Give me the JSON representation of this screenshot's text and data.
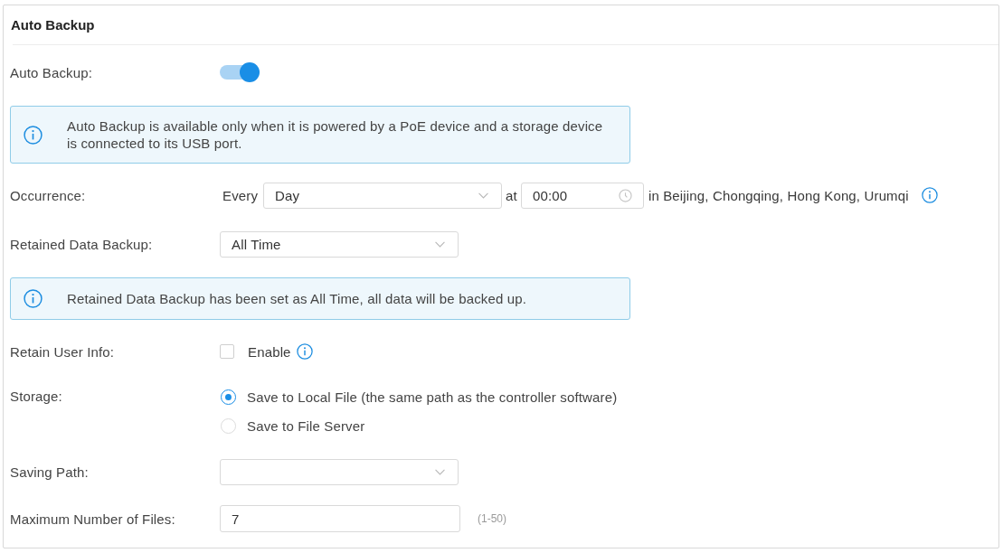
{
  "panel": {
    "title": "Auto Backup"
  },
  "rows": [
    {
      "kind": "toggle",
      "label": "Auto Backup:",
      "on": true
    },
    {
      "kind": "notice",
      "text": "Auto Backup is available only when it is powered by a PoE device and a storage device is connected to its USB port."
    },
    {
      "kind": "schedule",
      "label": "Occurrence:",
      "prefix": "Every",
      "select": {
        "value": "Day"
      },
      "connector": "at",
      "time": {
        "value": "00:00"
      },
      "suffix": "in Beijing, Chongqing, Hong Kong, Urumqi",
      "help": true
    },
    {
      "kind": "select",
      "label": "Retained Data Backup:",
      "value": "All Time"
    },
    {
      "kind": "notice",
      "text": "Retained Data Backup has been set as All Time, all data will be backed up."
    },
    {
      "kind": "checkbox",
      "label": "Retain User Info:",
      "option": "Enable",
      "checked": false,
      "help": true
    },
    {
      "kind": "radio",
      "label": "Storage:",
      "options": [
        {
          "label": "Save to Local File (the same path as the controller software)",
          "selected": true
        },
        {
          "label": "Save to File Server",
          "selected": false
        }
      ]
    },
    {
      "kind": "select",
      "label": "Saving Path:"
    },
    {
      "kind": "input",
      "label": "Maximum Number of Files:",
      "value": "7",
      "hint": "(1-50)"
    }
  ]
}
